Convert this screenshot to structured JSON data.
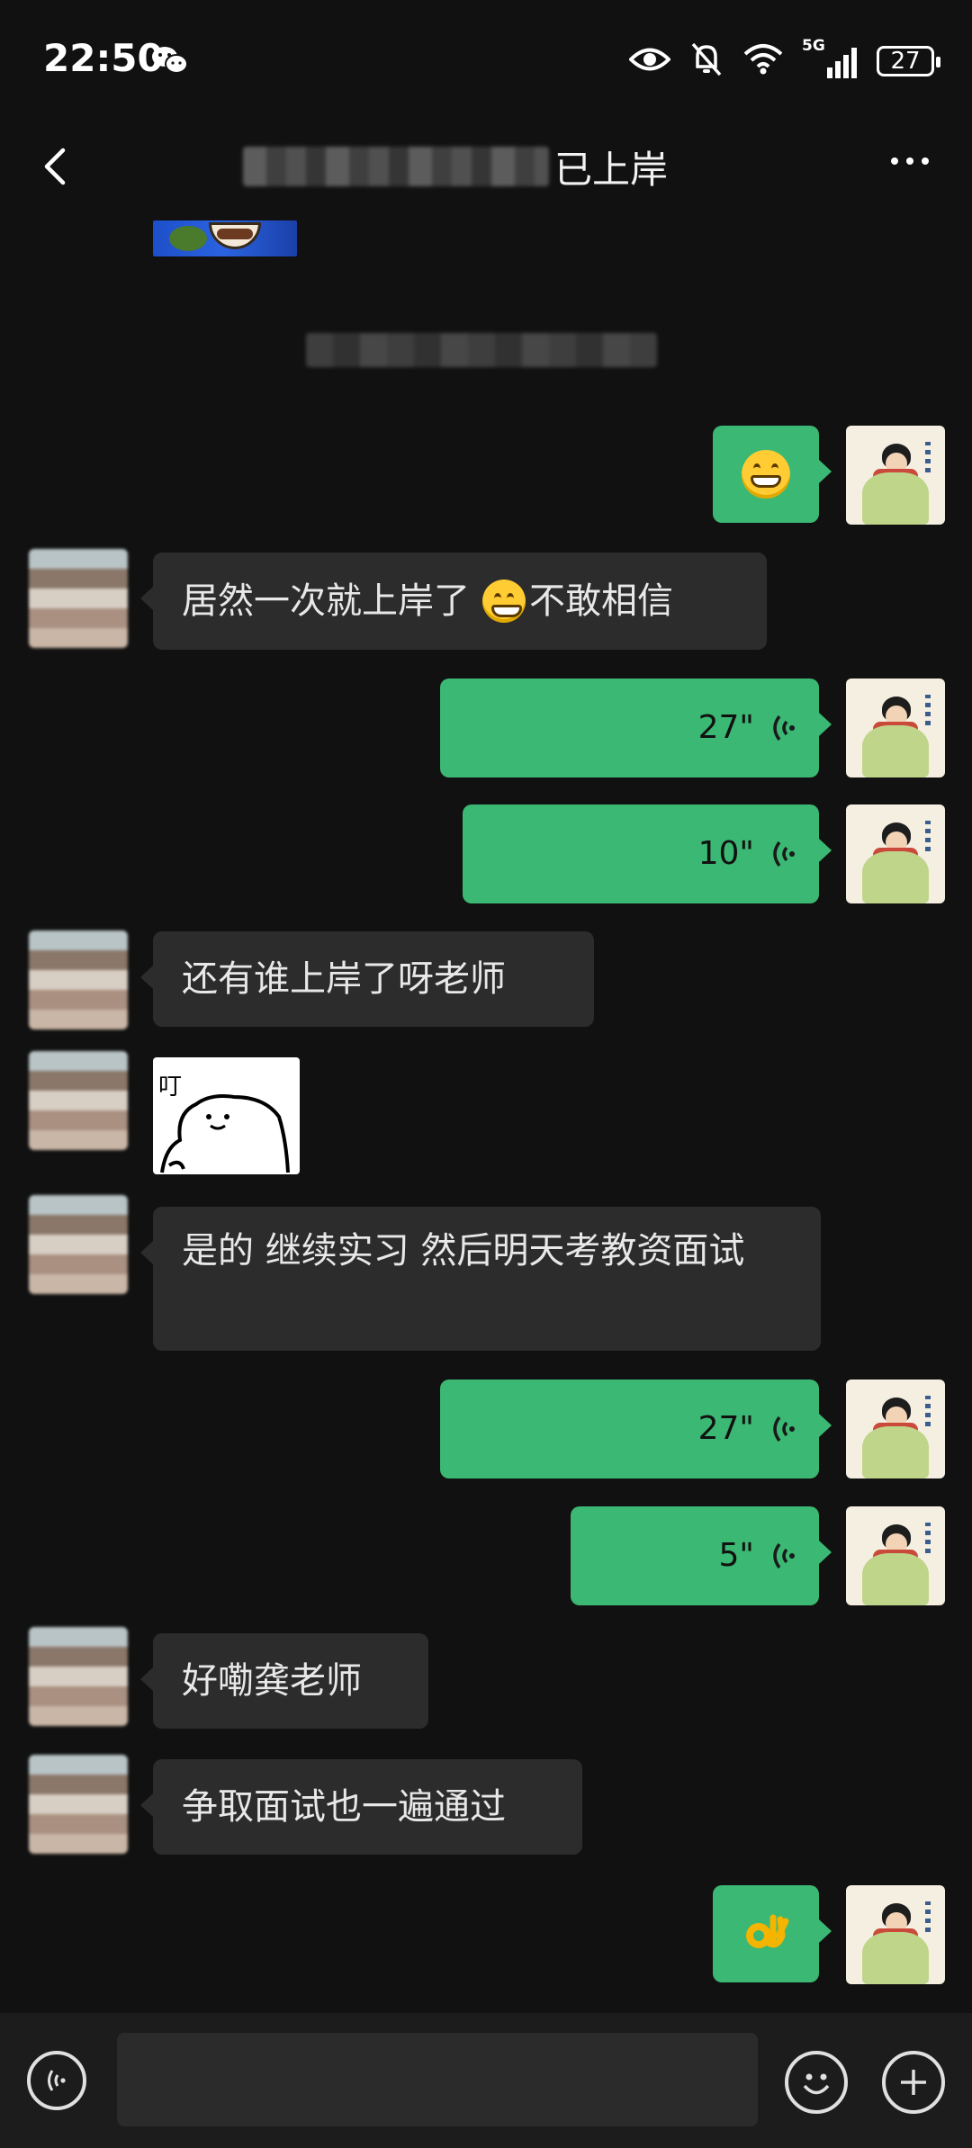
{
  "status_bar": {
    "time": "22:50",
    "battery": "27",
    "network": "5G",
    "icons": [
      "wechat-icon",
      "eye-icon",
      "mute-bell-icon",
      "wifi-icon",
      "signal-icon",
      "battery-icon"
    ]
  },
  "header": {
    "title_visible": "已上岸",
    "icons": [
      "back-chevron-icon",
      "more-dots-icon"
    ]
  },
  "messages": [
    {
      "from": "me",
      "type": "emoji",
      "emoji": "grinning-face"
    },
    {
      "from": "other",
      "type": "text",
      "text_before": "居然一次就上岸了",
      "emoji": "grinning-face",
      "text_after": "不敢相信"
    },
    {
      "from": "me",
      "type": "voice",
      "duration": "27\""
    },
    {
      "from": "me",
      "type": "voice",
      "duration": "10\""
    },
    {
      "from": "other",
      "type": "text",
      "text": "还有谁上岸了呀老师"
    },
    {
      "from": "other",
      "type": "sticker",
      "sticker_text": "叮"
    },
    {
      "from": "other",
      "type": "text",
      "text": "是的 继续实习 然后明天考教资面试"
    },
    {
      "from": "me",
      "type": "voice",
      "duration": "27\""
    },
    {
      "from": "me",
      "type": "voice",
      "duration": "5\""
    },
    {
      "from": "other",
      "type": "text",
      "text": "好嘞龚老师"
    },
    {
      "from": "other",
      "type": "text",
      "text": "争取面试也一遍通过"
    },
    {
      "from": "me",
      "type": "emoji",
      "emoji": "ok-hand"
    }
  ],
  "input_bar": {
    "placeholder": "",
    "icons": [
      "voice-input-icon",
      "emoji-icon",
      "plus-icon"
    ]
  }
}
